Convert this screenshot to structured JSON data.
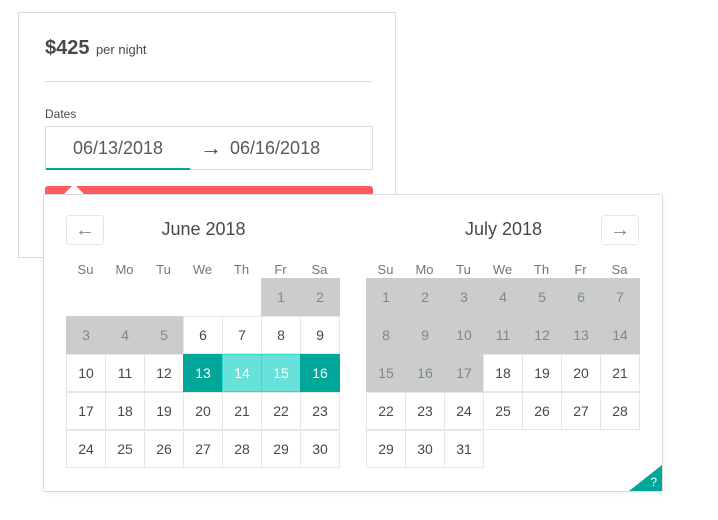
{
  "listing": {
    "price": "$425",
    "per_night": "per night",
    "dates_label": "Dates",
    "start_date": "06/13/2018",
    "end_date": "06/16/2018",
    "arrow": "→"
  },
  "nav": {
    "prev": "←",
    "next": "→",
    "help": "?"
  },
  "weekday_labels": [
    "Su",
    "Mo",
    "Tu",
    "We",
    "Th",
    "Fr",
    "Sa"
  ],
  "months": [
    {
      "title": "June 2018",
      "weeks": [
        [
          {
            "d": ""
          },
          {
            "d": ""
          },
          {
            "d": ""
          },
          {
            "d": ""
          },
          {
            "d": ""
          },
          {
            "d": "1",
            "s": "blocked"
          },
          {
            "d": "2",
            "s": "blocked"
          }
        ],
        [
          {
            "d": "3",
            "s": "blocked"
          },
          {
            "d": "4",
            "s": "blocked"
          },
          {
            "d": "5",
            "s": "blocked"
          },
          {
            "d": "6"
          },
          {
            "d": "7"
          },
          {
            "d": "8"
          },
          {
            "d": "9"
          }
        ],
        [
          {
            "d": "10"
          },
          {
            "d": "11"
          },
          {
            "d": "12"
          },
          {
            "d": "13",
            "s": "selected"
          },
          {
            "d": "14",
            "s": "span"
          },
          {
            "d": "15",
            "s": "span"
          },
          {
            "d": "16",
            "s": "selected"
          }
        ],
        [
          {
            "d": "17"
          },
          {
            "d": "18"
          },
          {
            "d": "19"
          },
          {
            "d": "20"
          },
          {
            "d": "21"
          },
          {
            "d": "22"
          },
          {
            "d": "23"
          }
        ],
        [
          {
            "d": "24"
          },
          {
            "d": "25"
          },
          {
            "d": "26"
          },
          {
            "d": "27"
          },
          {
            "d": "28"
          },
          {
            "d": "29"
          },
          {
            "d": "30"
          }
        ]
      ]
    },
    {
      "title": "July 2018",
      "weeks": [
        [
          {
            "d": "1",
            "s": "blocked"
          },
          {
            "d": "2",
            "s": "blocked"
          },
          {
            "d": "3",
            "s": "blocked"
          },
          {
            "d": "4",
            "s": "blocked"
          },
          {
            "d": "5",
            "s": "blocked"
          },
          {
            "d": "6",
            "s": "blocked"
          },
          {
            "d": "7",
            "s": "blocked"
          }
        ],
        [
          {
            "d": "8",
            "s": "blocked"
          },
          {
            "d": "9",
            "s": "blocked"
          },
          {
            "d": "10",
            "s": "blocked"
          },
          {
            "d": "11",
            "s": "blocked"
          },
          {
            "d": "12",
            "s": "blocked"
          },
          {
            "d": "13",
            "s": "blocked"
          },
          {
            "d": "14",
            "s": "blocked"
          }
        ],
        [
          {
            "d": "15",
            "s": "blocked"
          },
          {
            "d": "16",
            "s": "blocked"
          },
          {
            "d": "17",
            "s": "blocked"
          },
          {
            "d": "18"
          },
          {
            "d": "19"
          },
          {
            "d": "20"
          },
          {
            "d": "21"
          }
        ],
        [
          {
            "d": "22"
          },
          {
            "d": "23"
          },
          {
            "d": "24"
          },
          {
            "d": "25"
          },
          {
            "d": "26"
          },
          {
            "d": "27"
          },
          {
            "d": "28"
          }
        ],
        [
          {
            "d": "29"
          },
          {
            "d": "30"
          },
          {
            "d": "31"
          },
          {
            "d": ""
          },
          {
            "d": ""
          },
          {
            "d": ""
          },
          {
            "d": ""
          }
        ]
      ]
    }
  ],
  "colors": {
    "accent": "#00a699",
    "range": "#66e2da",
    "blocked": "#cacccd",
    "book_button": "#ff5a5f"
  }
}
